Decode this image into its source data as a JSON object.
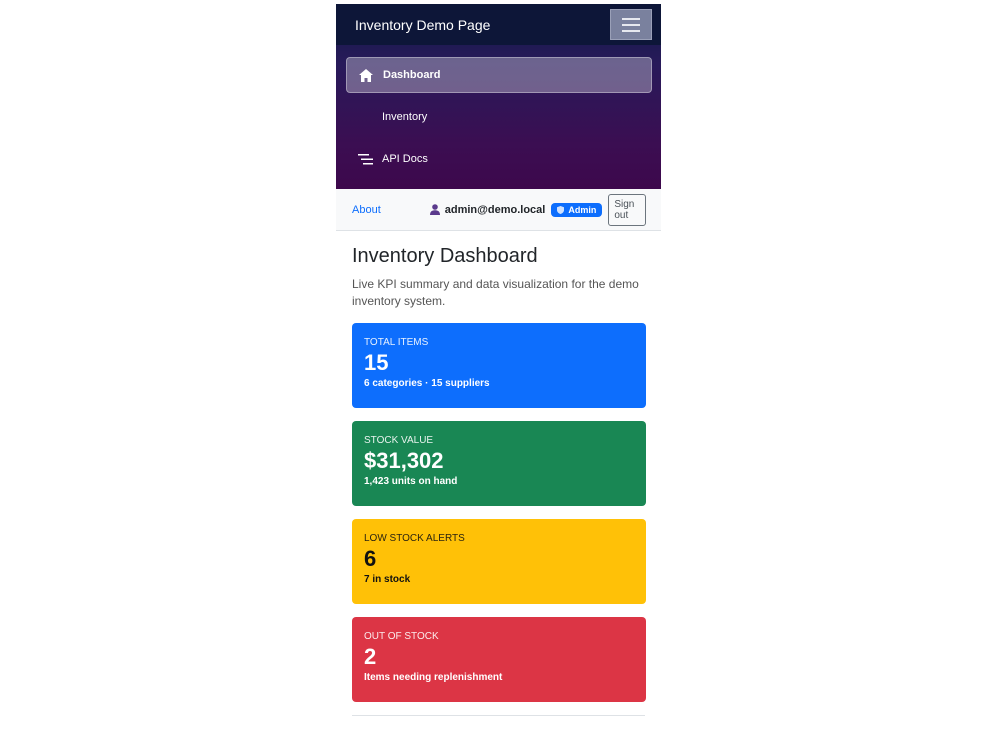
{
  "app": {
    "title": "Inventory Demo Page"
  },
  "sidebar": {
    "items": [
      {
        "label": "Dashboard",
        "icon": "home-icon",
        "active": true
      },
      {
        "label": "Inventory",
        "icon": "",
        "active": false
      },
      {
        "label": "API Docs",
        "icon": "list-icon",
        "active": false
      }
    ]
  },
  "userbar": {
    "about": "About",
    "user": "admin@demo.local",
    "role": "Admin",
    "signout": "Sign out"
  },
  "main": {
    "title": "Inventory Dashboard",
    "subtitle": "Live KPI summary and data visualization for the demo inventory system."
  },
  "kpis": [
    {
      "label": "TOTAL ITEMS",
      "value": "15",
      "detail": "6 categories · 15 suppliers",
      "color": "#0d6efd"
    },
    {
      "label": "STOCK VALUE",
      "value": "$31,302",
      "detail": "1,423 units on hand",
      "color": "#198754"
    },
    {
      "label": "LOW STOCK ALERTS",
      "value": "6",
      "detail": "7 in stock",
      "color": "#ffc107"
    },
    {
      "label": "OUT OF STOCK",
      "value": "2",
      "detail": "Items needing replenishment",
      "color": "#dc3545"
    }
  ]
}
